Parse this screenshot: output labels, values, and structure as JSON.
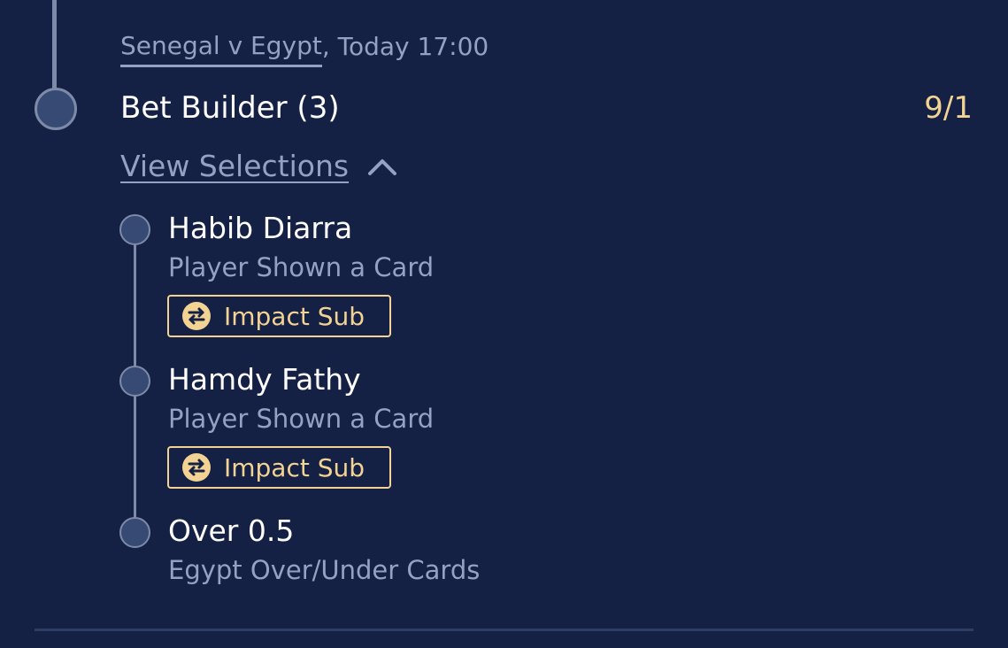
{
  "match": {
    "link_text": "Senegal v Egypt",
    "time_text": ", Today 17:00"
  },
  "bet": {
    "title": "Bet Builder (3)",
    "odds": "9/1",
    "view_selections_label": "View Selections"
  },
  "selections": [
    {
      "name": "Habib Diarra",
      "market": "Player Shown a Card",
      "badge": "Impact Sub"
    },
    {
      "name": "Hamdy Fathy",
      "market": "Player Shown a Card",
      "badge": "Impact Sub"
    },
    {
      "name": "Over 0.5",
      "market": "Egypt Over/Under Cards"
    }
  ],
  "icons": {
    "expand": "chevron-up-icon",
    "impact_sub": "swap-arrows-icon"
  },
  "colors": {
    "background": "#142044",
    "odds": "#f3d393",
    "badge": "#f3d393",
    "muted_text": "#93a2c2",
    "node_fill": "#364a74",
    "line": "#7d8aa8"
  }
}
